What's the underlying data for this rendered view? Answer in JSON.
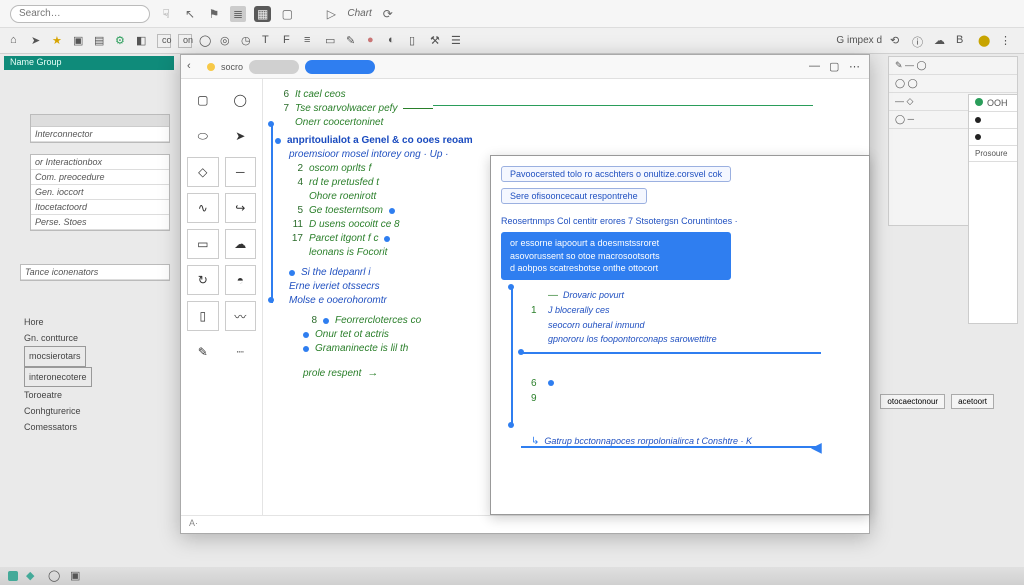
{
  "toolbar": {
    "search_placeholder": "Search…",
    "chart_label": "Chart"
  },
  "second_row": {
    "right_label": "impex d",
    "items": [
      "tool-a",
      "tool-b",
      "tool-c",
      "tool-d",
      "tool-e",
      "tool-f"
    ]
  },
  "bg_left": {
    "header": "Name  Group",
    "frames": [
      "Interconnector",
      "or Interactionbox",
      "Com. preocedure",
      "Gen. ioccort",
      "Itocetactoord",
      "Perse. Stoes",
      "Tance iconenators"
    ],
    "lower": [
      "Hore",
      "Gn. contturce",
      "mocsierotars",
      "interonecotere",
      "Toroeatre",
      "Conhgturerice",
      "Comessators"
    ]
  },
  "bg_right": {
    "ooh_label": "OOH",
    "prosoure_label": "Prosoure"
  },
  "side_buttons": {
    "a": "otocaectonour",
    "b": "acetoort"
  },
  "popup": {
    "title": "socro",
    "palette": [
      "square-icon",
      "circle-icon",
      "oval-icon",
      "arrow-icon",
      "diamond-icon",
      "line-icon",
      "curve-icon",
      "connector-icon",
      "box-icon",
      "cloud-icon",
      "loop-icon",
      "shape-icon",
      "rect-icon",
      "scribble-icon",
      "pen-icon",
      "dash-icon"
    ],
    "lines": [
      {
        "n": "6",
        "kind": "green",
        "text": "It cael ceos"
      },
      {
        "n": "7",
        "kind": "green",
        "text": "Tse sroarvolwacer pefy"
      },
      {
        "n": "",
        "kind": "green",
        "text": "Onerr coocertoninet"
      },
      {
        "n": "",
        "kind": "blueh",
        "text": "anpritoulialot a Genel & co ooes reoam"
      },
      {
        "n": "",
        "kind": "blue",
        "text": "proemsioor mosel intorey ong · Up ·"
      },
      {
        "n": "2",
        "kind": "green",
        "text": "oscom oprlts f"
      },
      {
        "n": "4",
        "kind": "green",
        "text": "rd te pretusfed t"
      },
      {
        "n": "",
        "kind": "green",
        "text": "Ohore roenirott"
      },
      {
        "n": "5",
        "kind": "green",
        "text": "Ge toesterntsom"
      },
      {
        "n": "11",
        "kind": "green",
        "text": "D usens oocoitt ce 8"
      },
      {
        "n": "17",
        "kind": "green",
        "text": "Parcet itgont f c"
      },
      {
        "n": "",
        "kind": "green",
        "text": "leonans is Focorit"
      },
      {
        "n": "",
        "kind": "blue",
        "text": "Si the Idepanrl i"
      },
      {
        "n": "",
        "kind": "blue",
        "text": "Erne iveriet otssecrs"
      },
      {
        "n": "",
        "kind": "blue",
        "text": "Molse e ooerohoromtr"
      },
      {
        "n": "8",
        "kind": "green",
        "text": "Feorrercloterces co"
      },
      {
        "n": "",
        "kind": "green",
        "text": "Onur tet ot actris"
      },
      {
        "n": "",
        "kind": "green",
        "text": "Gramaninecte is lil th"
      },
      {
        "n": "",
        "kind": "green",
        "text": "prole respent"
      }
    ]
  },
  "overlay": {
    "chip1": "Pavoocersted tolo ro acschters o onultize.corsvel cok",
    "chip2": "Sere ofisooncecaut respontrehe",
    "context": "Reosertnmps Col centitr erores 7 Stsotergsn Coruntintoes ·",
    "filled": [
      "or essorne iapoourt a doesmstssroret",
      "asovorussent so otoe macrosootsorts",
      "d aobpos scatresbotse onthe ottocort"
    ],
    "lines": [
      {
        "n": "",
        "text": "Drovaric povurt"
      },
      {
        "n": "1",
        "text": "J blocerally ces"
      },
      {
        "n": "",
        "text": "seocorn ouheral inmund"
      },
      {
        "n": "",
        "text": "gpnororu los foopontorconaps sarowettitre"
      },
      {
        "n": "6",
        "text": ""
      },
      {
        "n": "9",
        "text": ""
      },
      {
        "n": "",
        "text": "Gatrup bcctonnapoces rorpolonialirca t Conshtre · K"
      }
    ]
  }
}
